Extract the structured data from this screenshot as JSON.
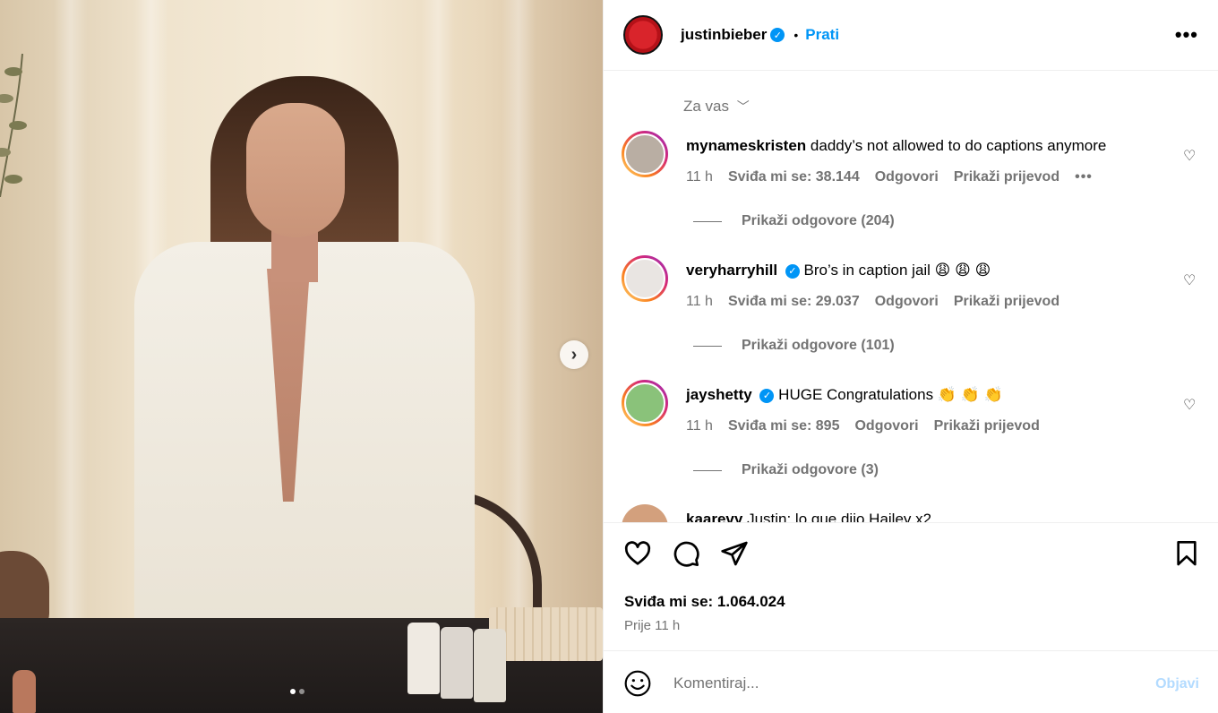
{
  "post": {
    "username": "justinbieber",
    "follow_label": "Prati",
    "separator": "•"
  },
  "comments_header": {
    "filter_label": "Za vas"
  },
  "comments": [
    {
      "username": "mynameskristen",
      "text": "daddy’s not allowed to do captions anymore",
      "time": "11 h",
      "likes": "Sviđa mi se: 38.144",
      "reply": "Odgovori",
      "translate": "Prikaži prijevod",
      "more": "•••",
      "replies": "Prikaži odgovore (204)",
      "avatar_color": "#b9aea3"
    },
    {
      "username": "veryharryhill",
      "text": "Bro’s in caption jail 😩 😩 😩",
      "time": "11 h",
      "likes": "Sviđa mi se: 29.037",
      "reply": "Odgovori",
      "translate": "Prikaži prijevod",
      "replies": "Prikaži odgovore (101)",
      "avatar_color": "#e9e5e2"
    },
    {
      "username": "jayshetty",
      "text": "HUGE Congratulations 👏 👏 👏",
      "time": "11 h",
      "likes": "Sviđa mi se: 895",
      "reply": "Odgovori",
      "translate": "Prikaži prijevod",
      "replies": "Prikaži odgovore (3)",
      "avatar_color": "#8ac27a"
    },
    {
      "username": "kaarevy",
      "text": "Justin: lo que dijo Hailey x2",
      "avatar_color": "#d3a07d"
    }
  ],
  "stats": {
    "likes": "Sviđa mi se: 1.064.024",
    "time": "Prije 11 h"
  },
  "composer": {
    "placeholder": "Komentiraj...",
    "post_label": "Objavi"
  },
  "colors": {
    "accent": "#0095f6",
    "muted": "#737373"
  }
}
